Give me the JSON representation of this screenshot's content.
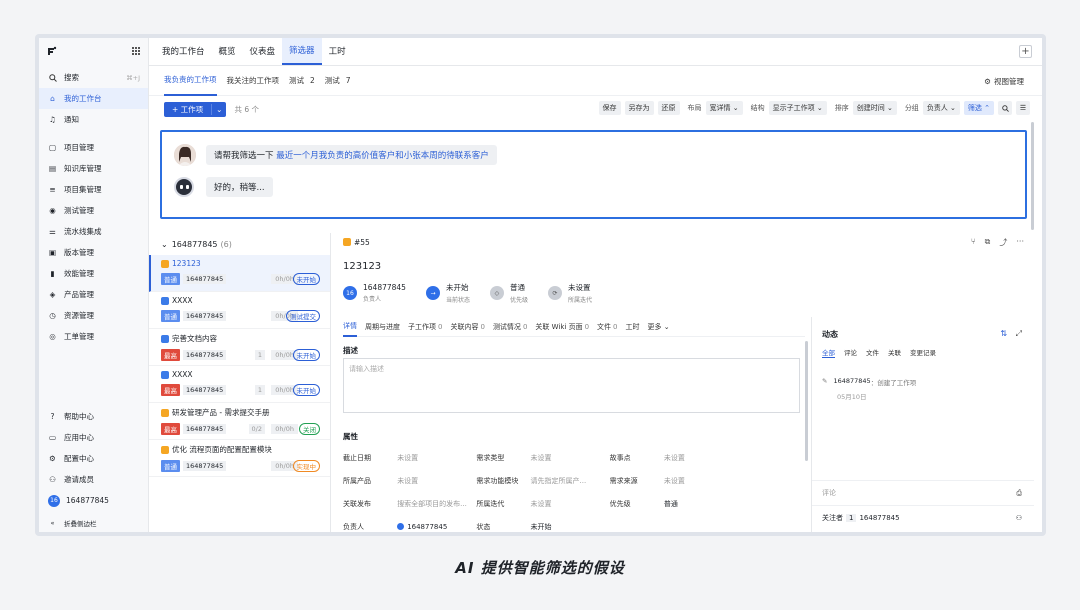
{
  "sidebar": {
    "search": {
      "label": "搜索",
      "shortcut": "⌘+J"
    },
    "items": [
      {
        "label": "我的工作台",
        "icon": "home-icon",
        "active": true
      },
      {
        "label": "通知",
        "icon": "bell-icon"
      },
      {
        "label": "项目管理",
        "icon": "project-icon"
      },
      {
        "label": "知识库管理",
        "icon": "doc-icon"
      },
      {
        "label": "项目集管理",
        "icon": "tree-icon"
      },
      {
        "label": "测试管理",
        "icon": "test-icon"
      },
      {
        "label": "流水线集成",
        "icon": "pipeline-icon"
      },
      {
        "label": "版本管理",
        "icon": "version-icon"
      },
      {
        "label": "效能管理",
        "icon": "chart-icon"
      },
      {
        "label": "产品管理",
        "icon": "product-icon"
      },
      {
        "label": "资源管理",
        "icon": "clock-icon"
      },
      {
        "label": "工单管理",
        "icon": "ticket-icon"
      }
    ],
    "bottom": [
      {
        "label": "帮助中心",
        "icon": "help-icon"
      },
      {
        "label": "应用中心",
        "icon": "app-icon"
      },
      {
        "label": "配置中心",
        "icon": "gear-icon"
      },
      {
        "label": "邀请成员",
        "icon": "user-add-icon"
      }
    ],
    "user": {
      "avatar": "16",
      "name": "164877845"
    },
    "collapse": "折叠侧边栏"
  },
  "topbar": {
    "tabs": [
      "我的工作台",
      "概览",
      "仪表盘",
      "筛选器",
      "工时"
    ],
    "active": 3
  },
  "subtabs": {
    "items": [
      {
        "label": "我负责的工作项",
        "count": ""
      },
      {
        "label": "我关注的工作项",
        "count": ""
      },
      {
        "label": "测试",
        "count": "2"
      },
      {
        "label": "测试",
        "count": "7"
      }
    ],
    "view_manage": "视图管理"
  },
  "toolbar": {
    "add": "+ 工作项",
    "count": "共 6 个",
    "save": "保存",
    "save_as": "另存为",
    "reset": "还原",
    "layout_label": "布局",
    "layout_value": "宽详情",
    "structure_label": "结构",
    "structure_value": "显示子工作项",
    "sort_label": "排序",
    "sort_value": "创建时间",
    "group_label": "分组",
    "group_value": "负责人",
    "filter": "筛选"
  },
  "chat": {
    "user_prefix": "请帮我筛选一下",
    "user_highlight": "最近一个月我负责的高价值客户和小张本周的待联系客户",
    "bot_reply": "好的，稍等..."
  },
  "list": {
    "group": "164877845",
    "group_count": "(6)",
    "cards": [
      {
        "title": "123123",
        "type": "o",
        "priority": "普通",
        "pclass": "n",
        "owner": "164877845",
        "sub": "",
        "hours": "0h/0h",
        "status": "未开始",
        "sclass": "blue",
        "selected": true
      },
      {
        "title": "XXXX",
        "type": "b",
        "priority": "普通",
        "pclass": "n",
        "owner": "164877845",
        "sub": "",
        "hours": "0h/0h",
        "status": "测试提交",
        "sclass": "blue"
      },
      {
        "title": "完善文档内容",
        "type": "b",
        "priority": "最高",
        "pclass": "h",
        "owner": "164877845",
        "sub": "1",
        "hours": "0h/0h",
        "status": "未开始",
        "sclass": "blue"
      },
      {
        "title": "XXXX",
        "type": "b",
        "priority": "最高",
        "pclass": "h",
        "owner": "164877845",
        "sub": "1",
        "hours": "0h/0h",
        "status": "未开始",
        "sclass": "blue"
      },
      {
        "title": "研发管理产品 - 需求提交手册",
        "type": "o",
        "priority": "最高",
        "pclass": "h",
        "owner": "164877845",
        "sub": "0/2",
        "hours": "0h/0h",
        "status": "关闭",
        "sclass": "green"
      },
      {
        "title": "优化 流程页面的配置配置模块",
        "type": "o",
        "priority": "普通",
        "pclass": "n",
        "owner": "164877845",
        "sub": "",
        "hours": "0h/0h",
        "status": "实现中",
        "sclass": "orange"
      }
    ]
  },
  "detail": {
    "id": "#55",
    "title": "123123",
    "meta": [
      {
        "value": "164877845",
        "label": "负责人",
        "badge": "16",
        "color": "#2f6fe8"
      },
      {
        "value": "未开始",
        "label": "当前状态",
        "badge": "→",
        "color": "#2f6fe8"
      },
      {
        "value": "普通",
        "label": "优先级",
        "badge": "◇",
        "color": "#c9cdd4"
      },
      {
        "value": "未设置",
        "label": "所属迭代",
        "badge": "⟳",
        "color": "#c9cdd4"
      }
    ],
    "tabs": [
      {
        "label": "详情",
        "n": ""
      },
      {
        "label": "周期与进度",
        "n": ""
      },
      {
        "label": "子工作项",
        "n": "0"
      },
      {
        "label": "关联内容",
        "n": "0"
      },
      {
        "label": "测试情况",
        "n": "0"
      },
      {
        "label": "关联 Wiki 页面",
        "n": "0"
      },
      {
        "label": "文件",
        "n": "0"
      },
      {
        "label": "工时",
        "n": ""
      },
      {
        "label": "更多 ⌄",
        "n": ""
      }
    ],
    "desc_title": "描述",
    "desc_placeholder": "请输入描述",
    "props_title": "属性",
    "props": [
      [
        [
          "截止日期",
          "未设置"
        ],
        [
          "需求类型",
          "未设置"
        ],
        [
          "故事点",
          "未设置"
        ]
      ],
      [
        [
          "所属产品",
          "未设置"
        ],
        [
          "需求功能模块",
          "请先指定所属产..."
        ],
        [
          "需求来源",
          "未设置"
        ]
      ],
      [
        [
          "关联发布",
          "搜索全部项目的发布..."
        ],
        [
          "所属迭代",
          "未设置"
        ],
        [
          "优先级",
          "普通"
        ]
      ],
      [
        [
          "负责人",
          "164877845"
        ],
        [
          "状态",
          "未开始"
        ],
        [
          "",
          ""
        ]
      ]
    ]
  },
  "activity": {
    "title": "动态",
    "tabs": [
      "全部",
      "评论",
      "文件",
      "关联",
      "变更记录"
    ],
    "item_who": "164877845",
    "item_msg": "：创建了工作项",
    "item_date": "05月10日",
    "comment": "评论",
    "follow_label": "关注者",
    "follow_count": "1",
    "follow_user": "164877845"
  },
  "caption": "AI 提供智能筛选的假设"
}
